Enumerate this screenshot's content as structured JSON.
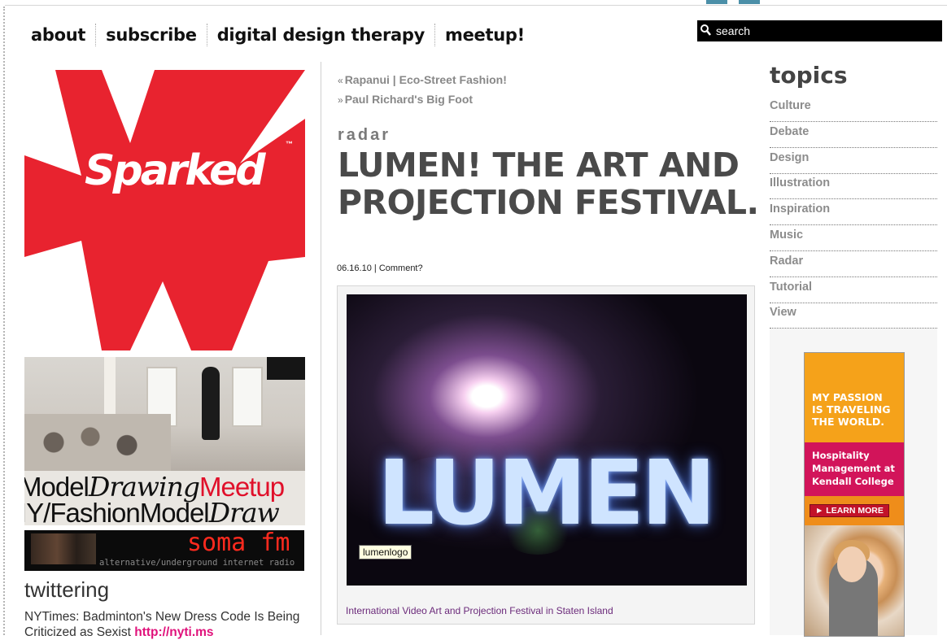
{
  "nav": {
    "items": [
      "about",
      "subscribe",
      "digital design therapy",
      "meetup!"
    ]
  },
  "search": {
    "placeholder": "search"
  },
  "left": {
    "logo_text": "Sparked",
    "logo_tm": "™",
    "meetup_line1": {
      "a": "Model",
      "b": "Drawing",
      "c": "Meetup"
    },
    "meetup_line2": {
      "a": "IY/",
      "b": "FashionModel",
      "c": "Draw"
    },
    "soma": {
      "logo": "soma fm",
      "tagline": "alternative/underground internet radio"
    },
    "twitter_heading": "twittering",
    "tweet_text": "NYTimes: Badminton's New Dress Code Is Being Criticized as Sexist",
    "tweet_link": "http://nyti.ms"
  },
  "post": {
    "prev": "Rapanui | Eco-Street Fashion!",
    "next": "Paul Richard's Big Foot",
    "category": "radar",
    "title": "LUMEN! THE ART AND PROJECTION FESTIVAL.",
    "date": "06.16.10",
    "comment": "Comment?",
    "image_text": "LUMEN",
    "tooltip": "lumenlogo",
    "caption": "International Video Art and Projection Festival in Staten Island"
  },
  "topics": {
    "heading": "topics",
    "items": [
      "Culture",
      "Debate",
      "Design",
      "Illustration",
      "Inspiration",
      "Music",
      "Radar",
      "Tutorial",
      "View"
    ]
  },
  "ad": {
    "headline": [
      "MY PASSION",
      "IS TRAVELING",
      "THE WORLD."
    ],
    "sub": [
      "Hospitality",
      "Management at",
      "Kendall College"
    ],
    "button": "► LEARN MORE"
  },
  "colors": {
    "accent_red": "#e8232f",
    "link_pink": "#e0127b",
    "caption_purple": "#6b2a7a",
    "ad_orange": "#f5a21a",
    "ad_magenta": "#d2145a"
  }
}
